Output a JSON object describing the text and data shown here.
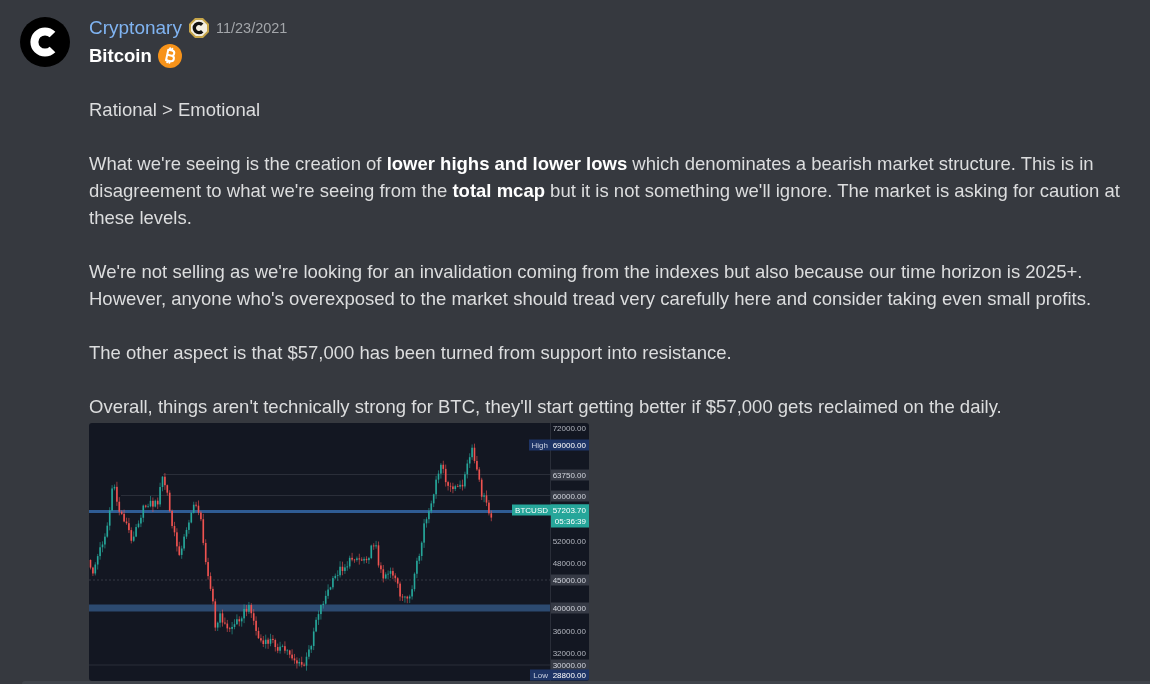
{
  "message": {
    "author": "Cryptonary",
    "timestamp": "11/23/2021",
    "title": "Bitcoin",
    "paragraphs": [
      "Rational > Emotional",
      "What we're seeing is the creation of **lower highs and lower lows** which denominates a bearish market structure. This is in disagreement to what we're seeing from the **total mcap** but it is not something we'll ignore. The market is asking for caution at these levels.",
      "We're not selling as we're looking for an invalidation coming from the indexes but also because our time horizon is 2025+. However, anyone who's overexposed to the market should tread very carefully here and consider taking even small profits.",
      "The other aspect is that $57,000 has been turned from support into resistance.",
      "Overall, things aren't technically strong for BTC, they'll start getting better if $57,000 gets reclaimed on the daily."
    ],
    "chart": {
      "price_labels": [
        {
          "kind": "plain",
          "value": "72000.00"
        },
        {
          "kind": "tagged",
          "tag": "High",
          "value": "69000.00"
        },
        {
          "kind": "boxed",
          "value": "63750.00"
        },
        {
          "kind": "boxed",
          "value": "60000.00"
        },
        {
          "kind": "current",
          "tag": "BTCUSD",
          "value": "57203.70",
          "countdown": "05:36:39"
        },
        {
          "kind": "plain",
          "value": "52000.00"
        },
        {
          "kind": "plain",
          "value": "48000.00"
        },
        {
          "kind": "boxed",
          "value": "45000.00"
        },
        {
          "kind": "boxed",
          "value": "40000.00"
        },
        {
          "kind": "plain",
          "value": "36000.00"
        },
        {
          "kind": "plain",
          "value": "32000.00"
        },
        {
          "kind": "boxed",
          "value": "30000.00"
        },
        {
          "kind": "tagged",
          "tag": "Low",
          "value": "28800.00"
        }
      ]
    }
  }
}
